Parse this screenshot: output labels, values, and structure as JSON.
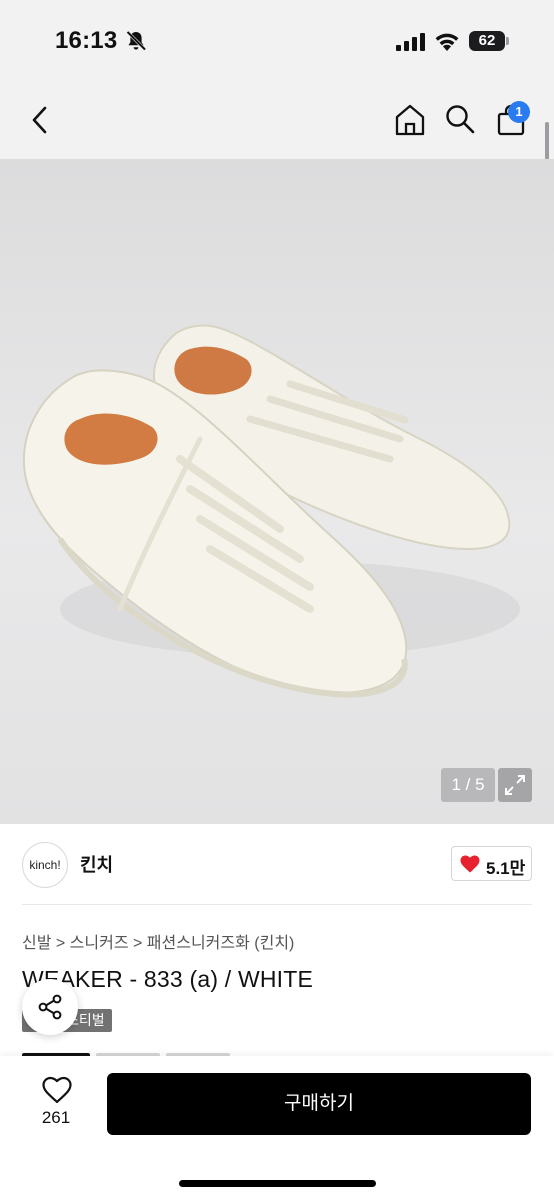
{
  "status_bar": {
    "time": "16:13",
    "battery": "62",
    "icons": [
      "bell-slash-icon",
      "cellular-signal-icon",
      "wifi-icon",
      "battery-icon"
    ]
  },
  "nav": {
    "icons": [
      "back-icon",
      "home-icon",
      "search-icon",
      "shopping-bag-icon"
    ],
    "cart_badge": "1",
    "accent_color": "#2a7af0"
  },
  "gallery": {
    "counter": "1 / 5",
    "expand_icon": "expand-icon"
  },
  "brand": {
    "logo_text": "kinch!",
    "name": "킨치",
    "likes": "5.1만",
    "heart_color": "#e8212e"
  },
  "product": {
    "breadcrumb": "신발 > 스니커즈 > 패션스니커즈화 (킨치)",
    "title": "WEAKER - 833 (a) / WHITE",
    "event_badge": "스티벌"
  },
  "share": {
    "icon": "share-icon"
  },
  "footer": {
    "wish_count": "261",
    "buy_label": "구매하기"
  }
}
